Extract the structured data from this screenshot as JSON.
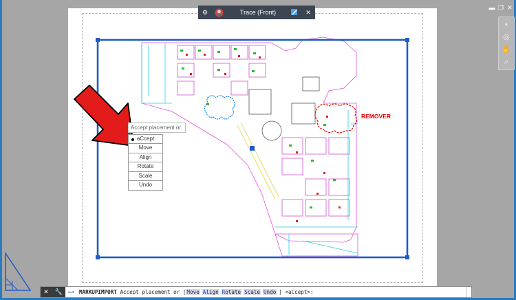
{
  "app": {
    "close_label": "✕"
  },
  "trace_bar": {
    "title": "Trace (Front)",
    "close_label": "✕"
  },
  "context_menu": {
    "prompt": "Accept placement or",
    "items": [
      "aCcept",
      "Move",
      "Align",
      "Rotate",
      "Scale",
      "Undo"
    ],
    "selected": "aCcept"
  },
  "markup": {
    "label": "REMOVER",
    "color": "#e00000"
  },
  "command_line": {
    "command": "MARKUPIMPORT",
    "prompt": "Accept placement or",
    "options": [
      {
        "key": "M",
        "rest": "ove"
      },
      {
        "key": "A",
        "rest": "lign"
      },
      {
        "key": "R",
        "rest": "otate"
      },
      {
        "key": "S",
        "rest": "cale"
      },
      {
        "key": "U",
        "rest": "ndo"
      }
    ],
    "default": "<aCcept>:"
  },
  "colors": {
    "accent": "#2b7bbf",
    "selection_blue": "#1f5cc4",
    "arrow_red": "#e41b1b"
  }
}
